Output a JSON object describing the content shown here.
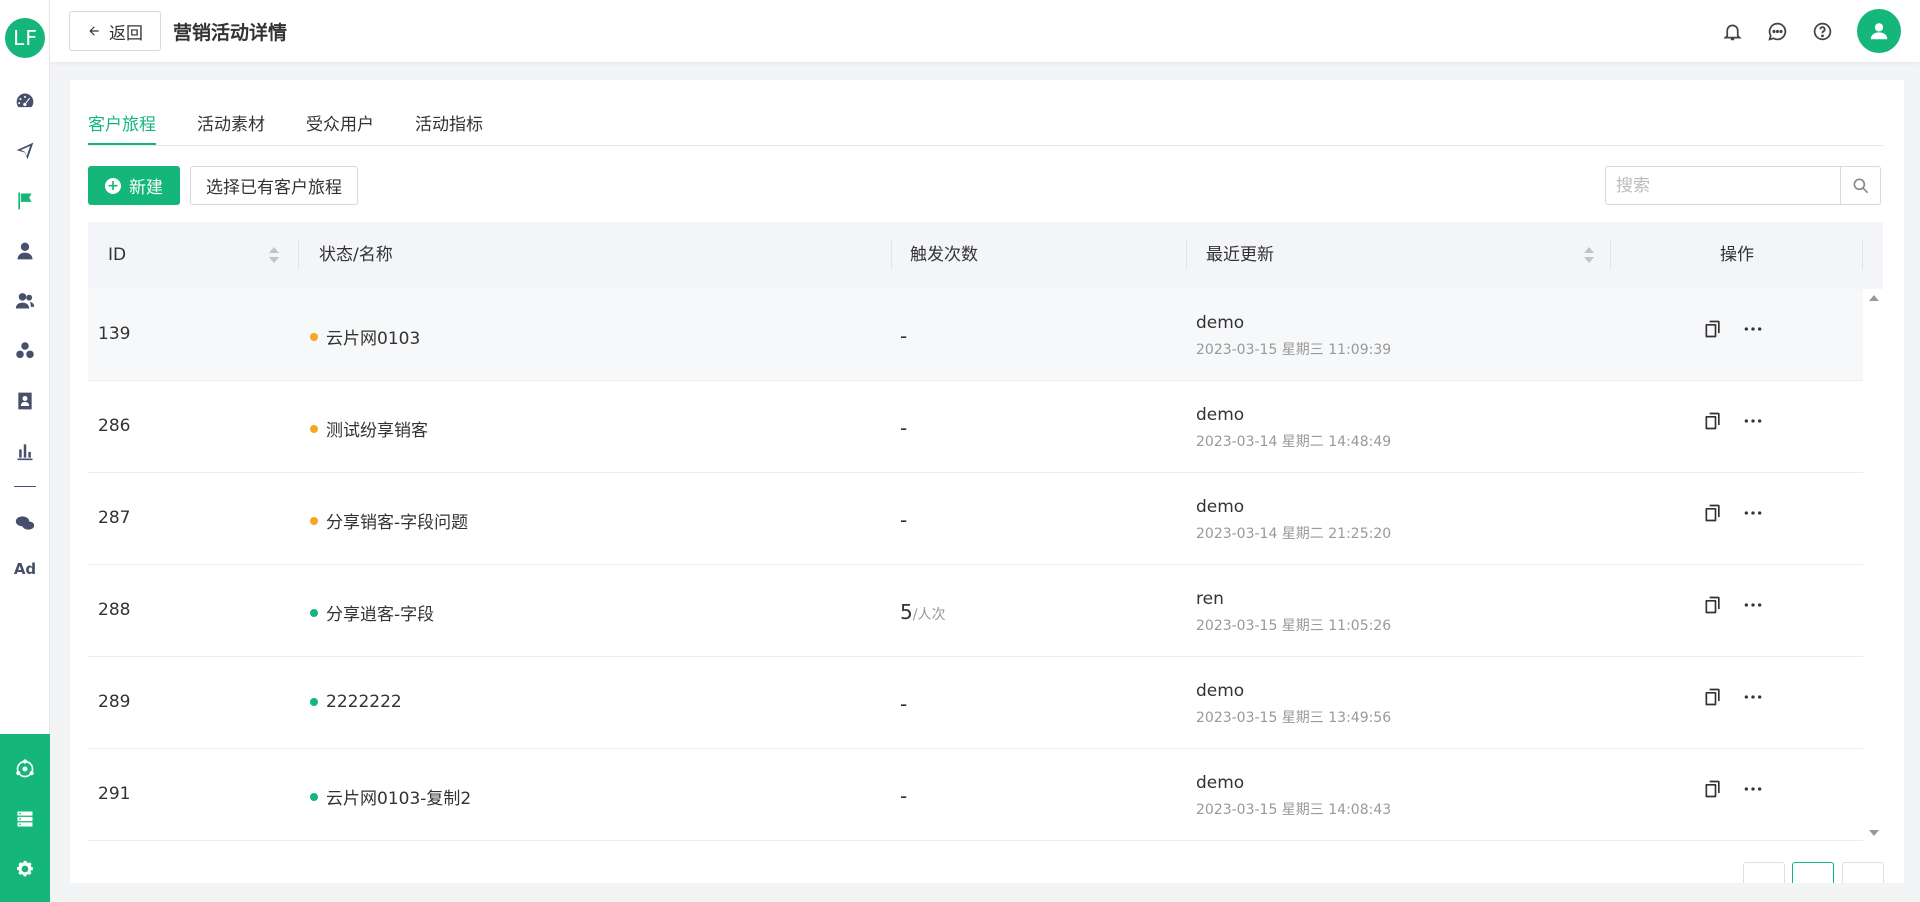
{
  "header": {
    "back_label": "返回",
    "title": "营销活动详情"
  },
  "tabs": [
    {
      "label": "客户旅程",
      "active": true
    },
    {
      "label": "活动素材",
      "active": false
    },
    {
      "label": "受众用户",
      "active": false
    },
    {
      "label": "活动指标",
      "active": false
    }
  ],
  "toolbar": {
    "new_label": "新建",
    "select_label": "选择已有客户旅程",
    "search_placeholder": "搜索"
  },
  "table": {
    "columns": [
      "ID",
      "状态/名称",
      "触发次数",
      "最近更新",
      "操作"
    ],
    "rows": [
      {
        "id": "139",
        "name": "云片网0103",
        "status_color": "#f5a623",
        "trigger": "-",
        "trigger_unit": "",
        "user": "demo",
        "time": "2023-03-15 星期三 11:09:39"
      },
      {
        "id": "286",
        "name": "测试纷享销客",
        "status_color": "#f5a623",
        "trigger": "-",
        "trigger_unit": "",
        "user": "demo",
        "time": "2023-03-14 星期二 14:48:49"
      },
      {
        "id": "287",
        "name": "分享销客-字段问题",
        "status_color": "#f5a623",
        "trigger": "-",
        "trigger_unit": "",
        "user": "demo",
        "time": "2023-03-14 星期二 21:25:20"
      },
      {
        "id": "288",
        "name": "分享逍客-字段",
        "status_color": "#14b67a",
        "trigger": "5",
        "trigger_unit": "/人次",
        "user": "ren",
        "time": "2023-03-15 星期三 11:05:26"
      },
      {
        "id": "289",
        "name": "2222222",
        "status_color": "#14b67a",
        "trigger": "-",
        "trigger_unit": "",
        "user": "demo",
        "time": "2023-03-15 星期三 13:49:56"
      },
      {
        "id": "291",
        "name": "云片网0103-复制2",
        "status_color": "#14b67a",
        "trigger": "-",
        "trigger_unit": "",
        "user": "demo",
        "time": "2023-03-15 星期三 14:08:43"
      }
    ]
  },
  "sidebar": {
    "logo_text": "LF",
    "ad_label": "Ad",
    "icons": [
      "dashboard-icon",
      "send-icon",
      "flag-icon",
      "user-icon",
      "users-icon",
      "segments-icon",
      "contact-card-icon",
      "bar-chart-icon",
      "wechat-icon",
      "ad-icon",
      "network-icon",
      "server-icon",
      "settings-icon"
    ]
  },
  "colors": {
    "accent": "#14b67a",
    "pending": "#f5a623",
    "active": "#14b67a"
  }
}
